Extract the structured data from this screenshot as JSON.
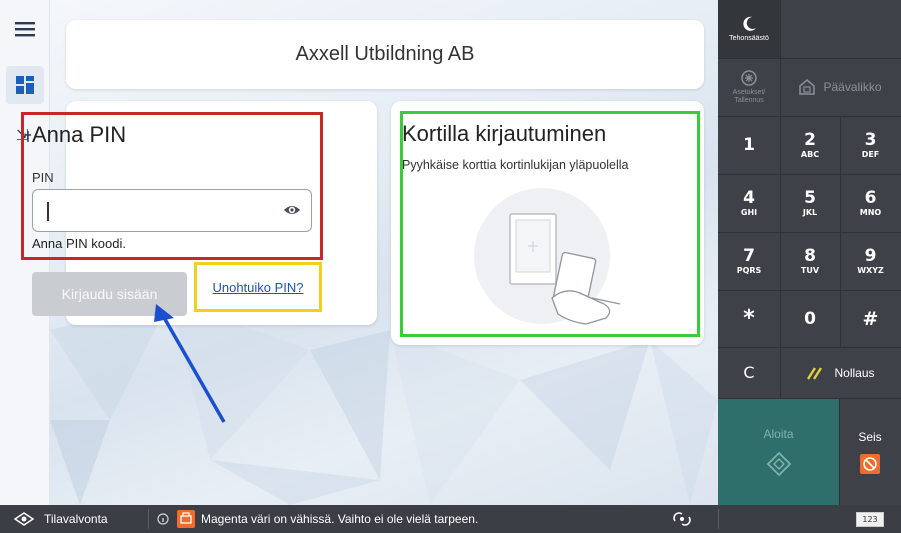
{
  "header": {
    "title": "Axxell Utbildning AB"
  },
  "pin_login": {
    "heading": "Anna PIN",
    "field_label": "PIN",
    "field_value": "",
    "hint": "Anna PIN koodi.",
    "login_button": "Kirjaudu sisään",
    "forgot_link": "Unohtuiko PIN?"
  },
  "card_login": {
    "heading": "Kortilla kirjautuminen",
    "instruction": "Pyyhkäise korttia kortinlukijan yläpuolella"
  },
  "keypad": {
    "energy_saver": "Tehonsäästö",
    "settings_line1": "Asetukset/",
    "settings_line2": "Tallennus",
    "main_menu": "Päävalikko",
    "keys": [
      {
        "digit": "1",
        "letters": ""
      },
      {
        "digit": "2",
        "letters": "ABC"
      },
      {
        "digit": "3",
        "letters": "DEF"
      },
      {
        "digit": "4",
        "letters": "GHI"
      },
      {
        "digit": "5",
        "letters": "JKL"
      },
      {
        "digit": "6",
        "letters": "MNO"
      },
      {
        "digit": "7",
        "letters": "PQRS"
      },
      {
        "digit": "8",
        "letters": "TUV"
      },
      {
        "digit": "9",
        "letters": "WXYZ"
      },
      {
        "digit": "*",
        "letters": ""
      },
      {
        "digit": "0",
        "letters": ""
      },
      {
        "digit": "#",
        "letters": ""
      }
    ],
    "clear": "C",
    "reset": "Nollaus",
    "start": "Aloita",
    "stop": "Seis"
  },
  "status_bar": {
    "status_monitor": "Tilavalvonta",
    "message": "Magenta väri on vähissä. Vaihto ei ole vielä tarpeen.",
    "keyboard_badge": "123"
  },
  "colors": {
    "pin_highlight": "#c62828",
    "forgot_highlight": "#f2d020",
    "card_highlight": "#3cc93c",
    "arrow": "#1a4fd0",
    "start_button": "#2f6f6b",
    "stop_icon": "#f26b2b"
  }
}
